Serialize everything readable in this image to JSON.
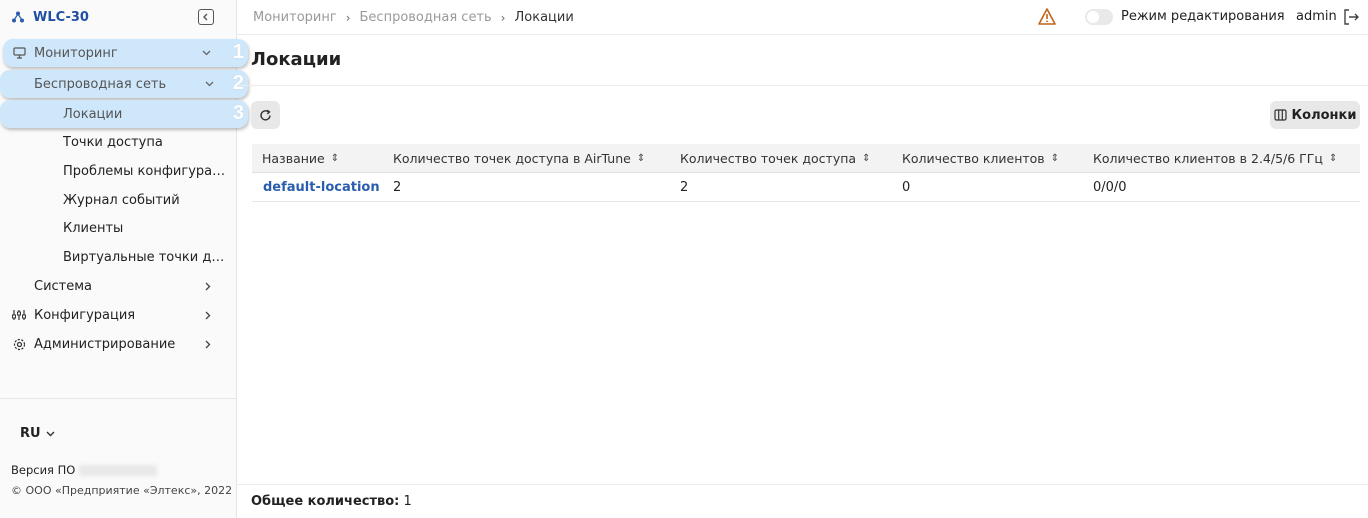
{
  "app": {
    "title": "WLC-30"
  },
  "sidebar": {
    "items": [
      {
        "label": "Мониторинг",
        "badge": "1"
      },
      {
        "label": "Беспроводная сеть",
        "badge": "2"
      },
      {
        "label": "Локации",
        "badge": "3"
      },
      {
        "label": "Точки доступа"
      },
      {
        "label": "Проблемы конфигурации"
      },
      {
        "label": "Журнал событий"
      },
      {
        "label": "Клиенты"
      },
      {
        "label": "Виртуальные точки дост..."
      },
      {
        "label": "Система"
      },
      {
        "label": "Конфигурация"
      },
      {
        "label": "Администрирование"
      }
    ],
    "language": "RU",
    "version_label": "Версия ПО",
    "copyright": "© ООО «Предприятие «Элтекс», 2022"
  },
  "header": {
    "breadcrumbs": [
      "Мониторинг",
      "Беспроводная сеть",
      "Локации"
    ],
    "edit_mode_label": "Режим редактирования",
    "user": "admin"
  },
  "main": {
    "title": "Локации",
    "columns_button": "Колонки",
    "table": {
      "headers": [
        "Название",
        "Количество точек доступа в AirTune",
        "Количество точек доступа",
        "Количество клиентов",
        "Количество клиентов в 2.4/5/6 ГГц"
      ],
      "rows": [
        [
          "default-location",
          "2",
          "2",
          "0",
          "0/0/0"
        ]
      ]
    },
    "total_label": "Общее количество:",
    "total_value": "1"
  },
  "colors": {
    "accent": "#2a5db0",
    "highlight": "#cfe7fb",
    "warning": "#c0641c"
  }
}
